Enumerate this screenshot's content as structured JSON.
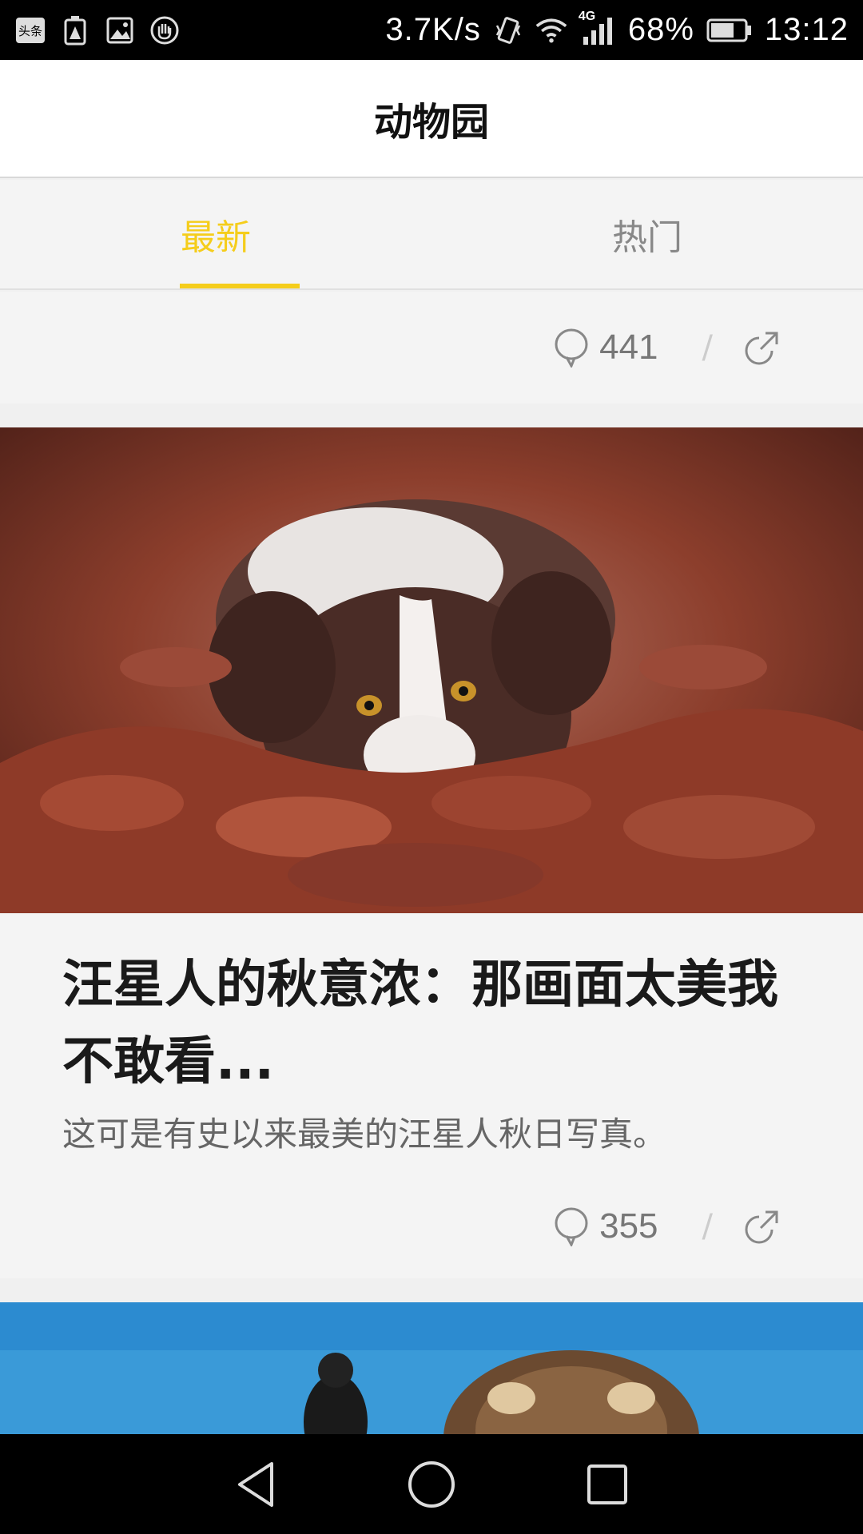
{
  "status_bar": {
    "network_speed": "3.7K/s",
    "network_type": "4G",
    "battery_percent": "68%",
    "time": "13:12",
    "notification_icons": [
      "toutiao-app-icon",
      "battery-alert-icon",
      "image-icon",
      "hand-icon"
    ]
  },
  "header": {
    "title": "动物园"
  },
  "tabs": [
    {
      "label": "最新",
      "active": true
    },
    {
      "label": "热门",
      "active": false
    }
  ],
  "top_card": {
    "comment_count": "441"
  },
  "article": {
    "title": "汪星人的秋意浓：那画面太美我不敢看...",
    "description": "这可是有史以来最美的汪星人秋日写真。",
    "comment_count": "355"
  },
  "separator_glyph": "/",
  "colors": {
    "accent": "#f5cd1b",
    "text_primary": "#1a1a1a",
    "text_secondary": "#666666",
    "background": "#f4f4f4"
  }
}
